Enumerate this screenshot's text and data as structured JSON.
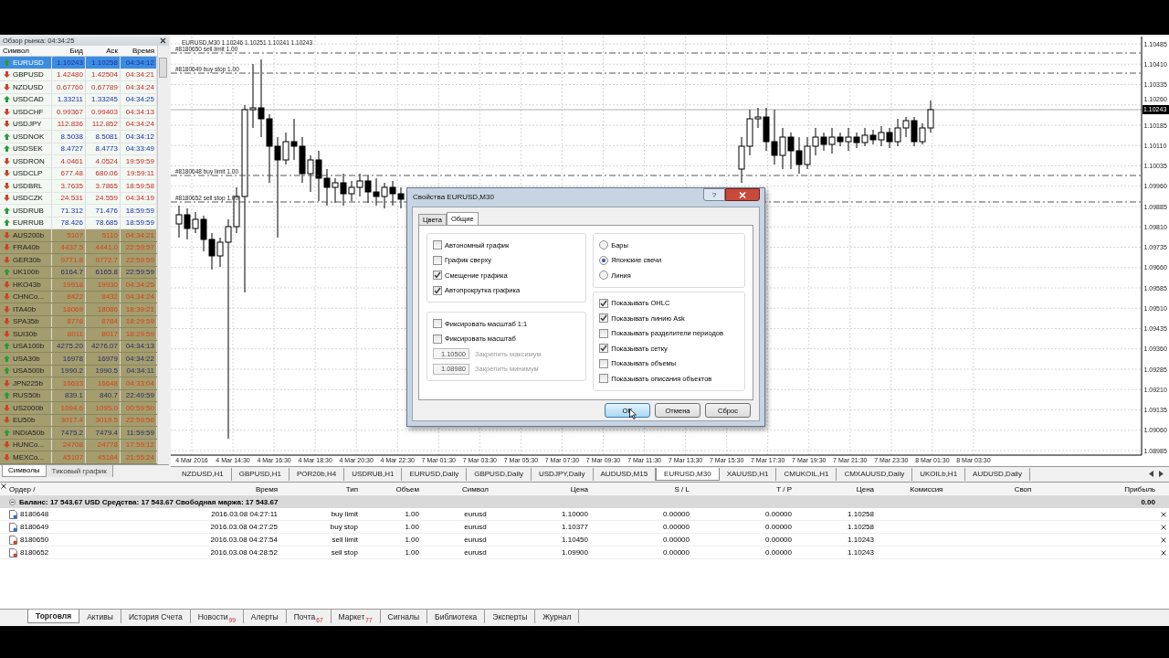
{
  "market_watch": {
    "title": "Обзор рынка: 04:34:25",
    "columns": [
      "Символ",
      "Бид",
      "Аск",
      "Время"
    ],
    "rows": [
      {
        "symbol": "EURUSD",
        "bid": "1.10243",
        "ask": "1.10258",
        "time": "04:34:12",
        "rising": true,
        "kind": "currency",
        "selected": true
      },
      {
        "symbol": "GBPUSD",
        "bid": "1.42480",
        "ask": "1.42504",
        "time": "04:34:21",
        "rising": false,
        "kind": "currency",
        "selected": false
      },
      {
        "symbol": "NZDUSD",
        "bid": "0.67760",
        "ask": "0.67789",
        "time": "04:34:24",
        "rising": false,
        "kind": "currency",
        "selected": false
      },
      {
        "symbol": "USDCAD",
        "bid": "1.33211",
        "ask": "1.33245",
        "time": "04:34:25",
        "rising": true,
        "kind": "currency",
        "selected": false
      },
      {
        "symbol": "USDCHF",
        "bid": "0.99367",
        "ask": "0.99403",
        "time": "04:34:13",
        "rising": false,
        "kind": "currency",
        "selected": false
      },
      {
        "symbol": "USDJPY",
        "bid": "112.836",
        "ask": "112.852",
        "time": "04:34:24",
        "rising": false,
        "kind": "currency",
        "selected": false
      },
      {
        "symbol": "USDNOK",
        "bid": "8.5038",
        "ask": "8.5081",
        "time": "04:34:12",
        "rising": true,
        "kind": "currency",
        "selected": false
      },
      {
        "symbol": "USDSEK",
        "bid": "8.4727",
        "ask": "8.4773",
        "time": "04:33:49",
        "rising": true,
        "kind": "currency",
        "selected": false
      },
      {
        "symbol": "USDRON",
        "bid": "4.0461",
        "ask": "4.0524",
        "time": "19:59:59",
        "rising": false,
        "kind": "currency",
        "selected": false
      },
      {
        "symbol": "USDCLP",
        "bid": "677.48",
        "ask": "680.06",
        "time": "19:59:11",
        "rising": false,
        "kind": "currency",
        "selected": false
      },
      {
        "symbol": "USDBRL",
        "bid": "3.7635",
        "ask": "3.7865",
        "time": "18:59:58",
        "rising": false,
        "kind": "currency",
        "selected": false
      },
      {
        "symbol": "USDCZK",
        "bid": "24.531",
        "ask": "24.559",
        "time": "04:34:19",
        "rising": false,
        "kind": "currency",
        "selected": false
      },
      {
        "symbol": "USDRUB",
        "bid": "71.312",
        "ask": "71.476",
        "time": "18:59:59",
        "rising": true,
        "kind": "currency",
        "selected": false
      },
      {
        "symbol": "EURRUB",
        "bid": "78.426",
        "ask": "78.685",
        "time": "18:59:59",
        "rising": true,
        "kind": "currency",
        "selected": false
      },
      {
        "symbol": "AUS200b",
        "bid": "5107",
        "ask": "5110",
        "time": "04:34:21",
        "rising": false,
        "kind": "index",
        "selected": false
      },
      {
        "symbol": "FRA40b",
        "bid": "4437.5",
        "ask": "4441.0",
        "time": "22:59:57",
        "rising": false,
        "kind": "index",
        "selected": false
      },
      {
        "symbol": "GER30b",
        "bid": "9771.8",
        "ask": "9772.7",
        "time": "22:59:59",
        "rising": false,
        "kind": "index",
        "selected": false
      },
      {
        "symbol": "UK100b",
        "bid": "6164.7",
        "ask": "6165.8",
        "time": "22:59:59",
        "rising": true,
        "kind": "index",
        "selected": false
      },
      {
        "symbol": "HKO43b",
        "bid": "19918",
        "ask": "19930",
        "time": "04:34:25",
        "rising": false,
        "kind": "index",
        "selected": false
      },
      {
        "symbol": "CHNCo...",
        "bid": "8422",
        "ask": "8432",
        "time": "04:34:24",
        "rising": false,
        "kind": "index",
        "selected": false
      },
      {
        "symbol": "ITA40b",
        "bid": "18069",
        "ask": "18086",
        "time": "18:39:21",
        "rising": false,
        "kind": "index",
        "selected": false
      },
      {
        "symbol": "SPA35b",
        "bid": "8778",
        "ask": "8784",
        "time": "18:29:59",
        "rising": false,
        "kind": "index",
        "selected": false
      },
      {
        "symbol": "SUI30b",
        "bid": "8011",
        "ask": "8017",
        "time": "18:29:59",
        "rising": false,
        "kind": "index",
        "selected": false
      },
      {
        "symbol": "USA100b",
        "bid": "4275.20",
        "ask": "4276.07",
        "time": "04:34:13",
        "rising": true,
        "kind": "index",
        "selected": false
      },
      {
        "symbol": "USA30b",
        "bid": "16978",
        "ask": "16979",
        "time": "04:34:22",
        "rising": true,
        "kind": "index",
        "selected": false
      },
      {
        "symbol": "USA500b",
        "bid": "1990.2",
        "ask": "1990.5",
        "time": "04:34:11",
        "rising": true,
        "kind": "index",
        "selected": false
      },
      {
        "symbol": "JPN225b",
        "bid": "16633",
        "ask": "16648",
        "time": "04:33:04",
        "rising": false,
        "kind": "index",
        "selected": false
      },
      {
        "symbol": "RUS50b",
        "bid": "839.1",
        "ask": "840.7",
        "time": "22:49:59",
        "rising": true,
        "kind": "index",
        "selected": false
      },
      {
        "symbol": "US2000b",
        "bid": "1094.6",
        "ask": "1095.0",
        "time": "00:59:50",
        "rising": false,
        "kind": "index",
        "selected": false
      },
      {
        "symbol": "EU50b",
        "bid": "3017.4",
        "ask": "3019.5",
        "time": "22:59:56",
        "rising": false,
        "kind": "index",
        "selected": false
      },
      {
        "symbol": "INDIA50b",
        "bid": "7475.2",
        "ask": "7479.4",
        "time": "11:59:59",
        "rising": true,
        "kind": "index",
        "selected": false
      },
      {
        "symbol": "HUNCo...",
        "bid": "24708",
        "ask": "24778",
        "time": "17:59:12",
        "rising": false,
        "kind": "index",
        "selected": false
      },
      {
        "symbol": "MEXCo...",
        "bid": "45107",
        "ask": "45184",
        "time": "21:55:24",
        "rising": false,
        "kind": "index",
        "selected": false
      }
    ],
    "tabs": [
      {
        "label": "Символы",
        "selected": true
      },
      {
        "label": "Тиковый график",
        "selected": false
      }
    ]
  },
  "chart": {
    "title": "EURUSD,M30 1.10246 1.10251 1.10241 1.10243",
    "order_lines": [
      {
        "label": "#8180650 sell limit 1.00"
      },
      {
        "label": "#8180649 buy stop 1.00"
      },
      {
        "label": "#8180648 buy limit 1.00"
      },
      {
        "label": "#8180652 sell stop 1.00"
      }
    ],
    "price_axis": [
      "1.10485",
      "1.10410",
      "1.10335",
      "1.10260",
      "1.10185",
      "1.10110",
      "1.10035",
      "1.09960",
      "1.09885",
      "1.09810",
      "1.09735",
      "1.09660",
      "1.09585",
      "1.09510",
      "1.09435",
      "1.09360",
      "1.09285",
      "1.09210",
      "1.09135",
      "1.09060",
      "1.08985"
    ],
    "current_price": "1.10243",
    "time_axis": [
      "4 Mar 2016",
      "4 Mar 14:30",
      "4 Mar 16:30",
      "4 Mar 18:30",
      "4 Mar 20:30",
      "4 Mar 22:30",
      "7 Mar 01:30",
      "7 Mar 03:30",
      "7 Mar 05:30",
      "7 Mar 07:30",
      "7 Mar 09:30",
      "7 Mar 11:30",
      "7 Mar 13:30",
      "7 Mar 15:30",
      "7 Mar 17:30",
      "7 Mar 19:30",
      "7 Mar 21:30",
      "7 Mar 23:30",
      "8 Mar 01:30",
      "8 Mar 03:30"
    ]
  },
  "chart_tabs": [
    {
      "label": "NZDUSD,H1",
      "selected": false
    },
    {
      "label": "GBPUSD,H1",
      "selected": false
    },
    {
      "label": "POR20b,H4",
      "selected": false
    },
    {
      "label": "USDRUB,H1",
      "selected": false
    },
    {
      "label": "EURUSD,Daily",
      "selected": false
    },
    {
      "label": "GBPUSD,Daily",
      "selected": false
    },
    {
      "label": "USDJPY,Daily",
      "selected": false
    },
    {
      "label": "AUDUSD,M15",
      "selected": false
    },
    {
      "label": "EURUSD,M30",
      "selected": true
    },
    {
      "label": "XAUUSD,H1",
      "selected": false
    },
    {
      "label": "CMUKOIL,H1",
      "selected": false
    },
    {
      "label": "CMXAUUSD,Daily",
      "selected": false
    },
    {
      "label": "UKOILb,H1",
      "selected": false
    },
    {
      "label": "AUDUSD,Daily",
      "selected": false
    }
  ],
  "dialog": {
    "title": "Свойства EURUSD,M30",
    "help_button": "?",
    "tabs": [
      {
        "label": "Цвета",
        "selected": false
      },
      {
        "label": "Общие",
        "selected": true
      }
    ],
    "left_groups": [
      {
        "items": [
          {
            "kind": "checkbox",
            "label": "Автономный график",
            "checked": false
          },
          {
            "kind": "checkbox",
            "label": "График сверху",
            "checked": false
          },
          {
            "kind": "checkbox",
            "label": "Смещение графика",
            "checked": true
          },
          {
            "kind": "checkbox",
            "label": "Автопрокрутка графика",
            "checked": true
          }
        ]
      },
      {
        "items": [
          {
            "kind": "checkbox",
            "label": "Фиксировать масштаб 1:1",
            "checked": false
          },
          {
            "kind": "checkbox",
            "label": "Фиксировать масштаб",
            "checked": false
          },
          {
            "kind": "field",
            "value": "1.10500",
            "label": "Закрепить максимум",
            "disabled": true
          },
          {
            "kind": "field",
            "value": "1.08980",
            "label": "Закрепить минимум",
            "disabled": true
          }
        ]
      }
    ],
    "right_groups": [
      {
        "items": [
          {
            "kind": "radio",
            "label": "Бары",
            "selected": false
          },
          {
            "kind": "radio",
            "label": "Японские свечи",
            "selected": true
          },
          {
            "kind": "radio",
            "label": "Линия",
            "selected": false
          }
        ]
      },
      {
        "items": [
          {
            "kind": "checkbox",
            "label": "Показывать OHLC",
            "checked": true
          },
          {
            "kind": "checkbox",
            "label": "Показывать линию Ask",
            "checked": true
          },
          {
            "kind": "checkbox",
            "label": "Показывать разделители периодов",
            "checked": false
          },
          {
            "kind": "checkbox",
            "label": "Показывать сетку",
            "checked": true
          },
          {
            "kind": "checkbox",
            "label": "Показывать объемы",
            "checked": false
          },
          {
            "kind": "checkbox",
            "label": "Показывать описания объектов",
            "checked": false
          }
        ]
      }
    ],
    "buttons": [
      {
        "label": "OK",
        "default": true
      },
      {
        "label": "Отмена",
        "default": false
      },
      {
        "label": "Сброс",
        "default": false
      }
    ]
  },
  "terminal": {
    "columns": [
      "Ордер /",
      "Время",
      "Тип",
      "Объем",
      "Символ",
      "Цена",
      "S / L",
      "T / P",
      "Цена",
      "Комиссия",
      "Своп",
      "Прибыль"
    ],
    "balance": {
      "text": "Баланс: 17 543.67 USD  Средства: 17 543.67  Свободная маржа: 17 543.67",
      "profit": "0.00"
    },
    "rows": [
      {
        "cells": [
          "8180648",
          "2016.03.08 04:27:11",
          "buy limit",
          "1.00",
          "eurusd",
          "1.10000",
          "0.00000",
          "0.00000",
          "1.10258"
        ],
        "kind": "buy"
      },
      {
        "cells": [
          "8180649",
          "2016.03.08 04:27:25",
          "buy stop",
          "1.00",
          "eurusd",
          "1.10377",
          "0.00000",
          "0.00000",
          "1.10258"
        ],
        "kind": "buy"
      },
      {
        "cells": [
          "8180650",
          "2016.03.08 04:27:54",
          "sell limit",
          "1.00",
          "eurusd",
          "1.10450",
          "0.00000",
          "0.00000",
          "1.10243"
        ],
        "kind": "sell"
      },
      {
        "cells": [
          "8180652",
          "2016.03.08 04:28:52",
          "sell stop",
          "1.00",
          "eurusd",
          "1.09900",
          "0.00000",
          "0.00000",
          "1.10243"
        ],
        "kind": "sell"
      }
    ],
    "tabs": [
      {
        "label": "Торговля",
        "selected": true
      },
      {
        "label": "Активы",
        "selected": false
      },
      {
        "label": "История Счета",
        "selected": false
      },
      {
        "label": "Новости",
        "badge": "99",
        "selected": false
      },
      {
        "label": "Алерты",
        "selected": false
      },
      {
        "label": "Почта",
        "badge": "67",
        "selected": false
      },
      {
        "label": "Маркет",
        "badge": "77",
        "selected": false
      },
      {
        "label": "Сигналы",
        "selected": false
      },
      {
        "label": "Библиотека",
        "selected": false
      },
      {
        "label": "Эксперты",
        "selected": false
      },
      {
        "label": "Журнал",
        "selected": false
      }
    ]
  }
}
